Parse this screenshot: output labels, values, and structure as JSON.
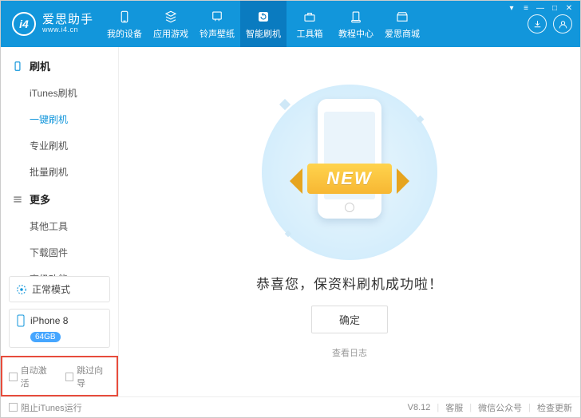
{
  "brand": {
    "name": "爱思助手",
    "url": "www.i4.cn",
    "logo_text": "i4"
  },
  "nav": [
    {
      "label": "我的设备",
      "icon": "phone"
    },
    {
      "label": "应用游戏",
      "icon": "apps"
    },
    {
      "label": "铃声壁纸",
      "icon": "music"
    },
    {
      "label": "智能刷机",
      "icon": "refresh",
      "active": true
    },
    {
      "label": "工具箱",
      "icon": "toolbox"
    },
    {
      "label": "教程中心",
      "icon": "book"
    },
    {
      "label": "爱思商城",
      "icon": "store"
    }
  ],
  "sidebar": {
    "sections": [
      {
        "title": "刷机",
        "items": [
          "iTunes刷机",
          "一键刷机",
          "专业刷机",
          "批量刷机"
        ],
        "active_index": 1
      },
      {
        "title": "更多",
        "items": [
          "其他工具",
          "下载固件",
          "高级功能"
        ],
        "active_index": -1
      }
    ],
    "mode": "正常模式",
    "device": {
      "name": "iPhone 8",
      "storage": "64GB"
    },
    "checkboxes": {
      "auto_activate": "自动激活",
      "skip_guide": "跳过向导"
    }
  },
  "main": {
    "ribbon_text": "NEW",
    "success_text": "恭喜您，保资料刷机成功啦！",
    "ok_button": "确定",
    "view_log": "查看日志"
  },
  "statusbar": {
    "block_itunes": "阻止iTunes运行",
    "version": "V8.12",
    "support": "客服",
    "wechat": "微信公众号",
    "update": "检查更新"
  }
}
